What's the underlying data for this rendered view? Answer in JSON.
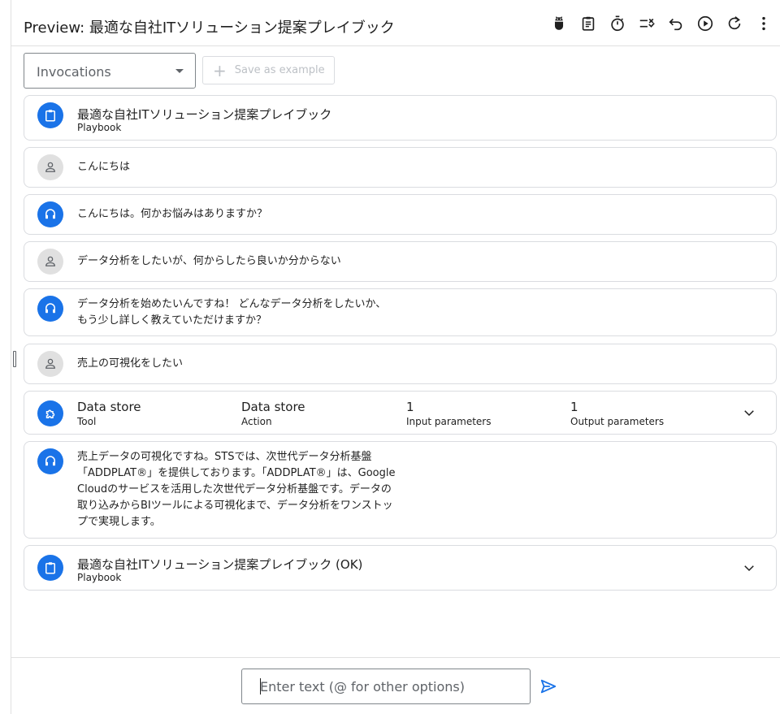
{
  "header": {
    "title": "Preview: 最適な自社ITソリューション提案プレイブック",
    "toolbar_icons": [
      "bug-icon",
      "clipboard-icon",
      "timer-icon",
      "checklist-icon",
      "undo-icon",
      "play-icon",
      "refresh-icon",
      "more-vert-icon"
    ]
  },
  "controls": {
    "invocations_select": "Invocations",
    "save_example": "Save as example"
  },
  "cards": {
    "c0": {
      "title": "最適な自社ITソリューション提案プレイブック",
      "subtitle": "Playbook"
    },
    "c1": {
      "text": "こんにちは"
    },
    "c2": {
      "text": "こんにちは。何かお悩みはありますか？"
    },
    "c3": {
      "text": "データ分析をしたいが、何からしたら良いか分からない"
    },
    "c4": {
      "line1": "データ分析を始めたいんですね！ どんなデータ分析をしたいか、",
      "line2": "もう少し詳しく教えていただけますか？"
    },
    "c5": {
      "text": "売上の可視化をしたい"
    },
    "c6": {
      "columns": [
        {
          "main": "Data store",
          "sub": "Tool"
        },
        {
          "main": "Data store",
          "sub": "Action"
        },
        {
          "main": "1",
          "sub": "Input parameters"
        },
        {
          "main": "1",
          "sub": "Output parameters"
        }
      ]
    },
    "c7": {
      "line1": "売上データの可視化ですね。STSでは、次世代データ分析基盤",
      "line2": "「ADDPLAT®」を提供しております。「ADDPLAT®」は、Google",
      "line3": "Cloudのサービスを活用した次世代データ分析基盤です。データの",
      "line4": "取り込みからBIツールによる可視化まで、データ分析をワンストッ",
      "line5": "プで実現します。"
    },
    "c8": {
      "title": "最適な自社ITソリューション提案プレイブック (OK)",
      "subtitle": "Playbook"
    }
  },
  "footer": {
    "input_placeholder": "Enter text (@ for other options)"
  },
  "colors": {
    "accent": "#1a73e8",
    "user_avatar_bg": "#e0e0e0",
    "border": "#dadce0"
  }
}
